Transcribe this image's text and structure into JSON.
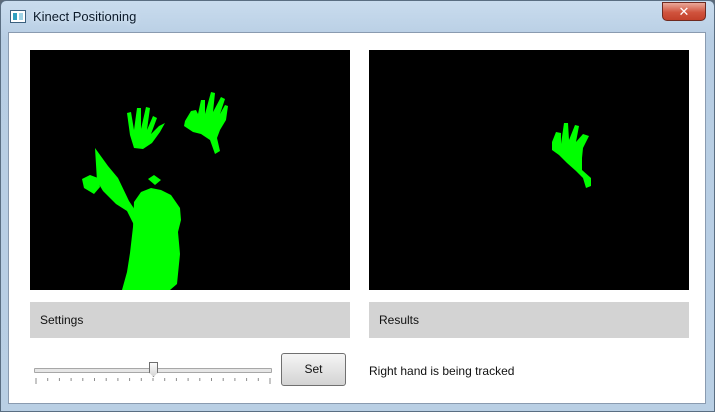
{
  "window": {
    "title": "Kinect Positioning",
    "close_label": "✕"
  },
  "left_panel": {
    "header": "Settings",
    "set_button_label": "Set"
  },
  "right_panel": {
    "header": "Results",
    "status": "Right hand is being tracked"
  },
  "slider": {
    "value_fraction": 0.5
  },
  "colors": {
    "depth_silhouette": "#00ff00",
    "view_background": "#000000",
    "header_bar": "#d3d3d3"
  }
}
